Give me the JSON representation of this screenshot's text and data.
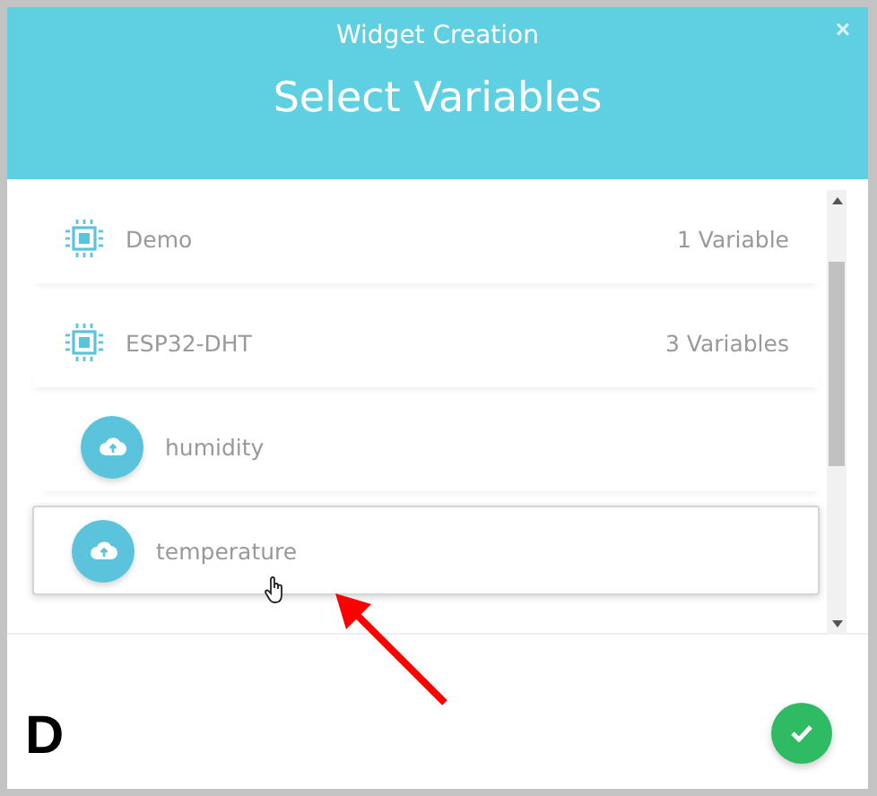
{
  "dialog": {
    "subtitle": "Widget Creation",
    "title": "Select Variables",
    "close": "×"
  },
  "items": [
    {
      "kind": "device",
      "name": "Demo",
      "count": "1 Variable",
      "highlighted": false
    },
    {
      "kind": "device",
      "name": "ESP32-DHT",
      "count": "3 Variables",
      "highlighted": false
    },
    {
      "kind": "variable",
      "name": "humidity",
      "highlighted": false
    },
    {
      "kind": "variable",
      "name": "temperature",
      "highlighted": true
    }
  ],
  "annotation": {
    "letter": "D"
  }
}
